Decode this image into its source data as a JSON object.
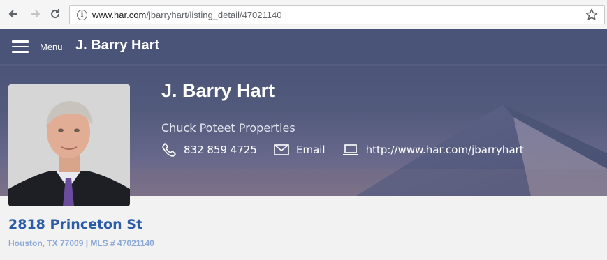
{
  "browser": {
    "url_host": "www.har.com",
    "url_path": "/jbarryhart/listing_detail/47021140"
  },
  "nav": {
    "menu_label": "Menu",
    "title": "J. Barry Hart"
  },
  "agent": {
    "name": "J. Barry Hart",
    "company": "Chuck Poteet Properties",
    "phone": "832 859 4725",
    "email_label": "Email",
    "website": "http://www.har.com/jbarryhart"
  },
  "listing": {
    "address": "2818 Princeton St",
    "location_line": "Houston, TX 77009 | MLS # 47021140"
  },
  "colors": {
    "nav_bg": "#4a5478",
    "address_blue": "#2c5ca6",
    "sub_blue": "#8aa8d6"
  }
}
